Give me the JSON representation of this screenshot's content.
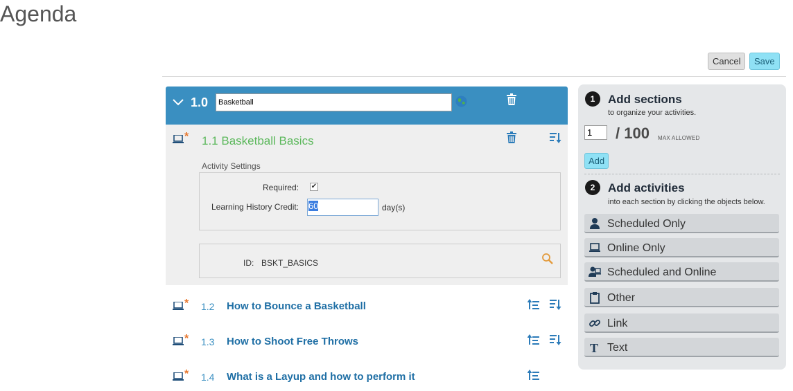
{
  "page": {
    "title": "Agenda"
  },
  "toolbar": {
    "cancel_label": "Cancel",
    "save_label": "Save"
  },
  "section": {
    "number": "1.0",
    "name_value": "Basketball"
  },
  "expanded_activity": {
    "title": "1.1 Basketball Basics",
    "settings_label": "Activity Settings",
    "required_label": "Required:",
    "required_checked": true,
    "credit_label": "Learning History Credit:",
    "credit_value": "60",
    "credit_unit": "day(s)",
    "id_label": "ID:",
    "id_value": "BSKT_BASICS"
  },
  "activities": [
    {
      "number": "1.2",
      "title": "How to Bounce a Basketball"
    },
    {
      "number": "1.3",
      "title": "How to Shoot Free Throws"
    },
    {
      "number": "1.4",
      "title": "What is a Layup and how to perform it"
    }
  ],
  "panel": {
    "step1": {
      "number": "1",
      "title": "Add sections",
      "subtitle": "to organize your activities."
    },
    "count_value": "1",
    "max_text": "/ 100",
    "max_allowed": "MAX ALLOWED",
    "add_label": "Add",
    "step2": {
      "number": "2",
      "title": "Add activities",
      "subtitle": "into each section by clicking the objects below."
    },
    "activity_types": [
      {
        "label": "Scheduled Only",
        "icon": "person-icon"
      },
      {
        "label": "Online Only",
        "icon": "laptop-icon"
      },
      {
        "label": "Scheduled and Online",
        "icon": "person-laptop-icon"
      },
      {
        "label": "Other",
        "icon": "clipboard-icon"
      },
      {
        "label": "Link",
        "icon": "link-icon"
      },
      {
        "label": "Text",
        "icon": "text-icon"
      }
    ]
  },
  "colors": {
    "section_header": "#3a8fc1",
    "expanded_title": "#5cb85c",
    "activity_title": "#1f6fa5",
    "star": "#e8772e",
    "save_button": "#8fe1f5"
  }
}
